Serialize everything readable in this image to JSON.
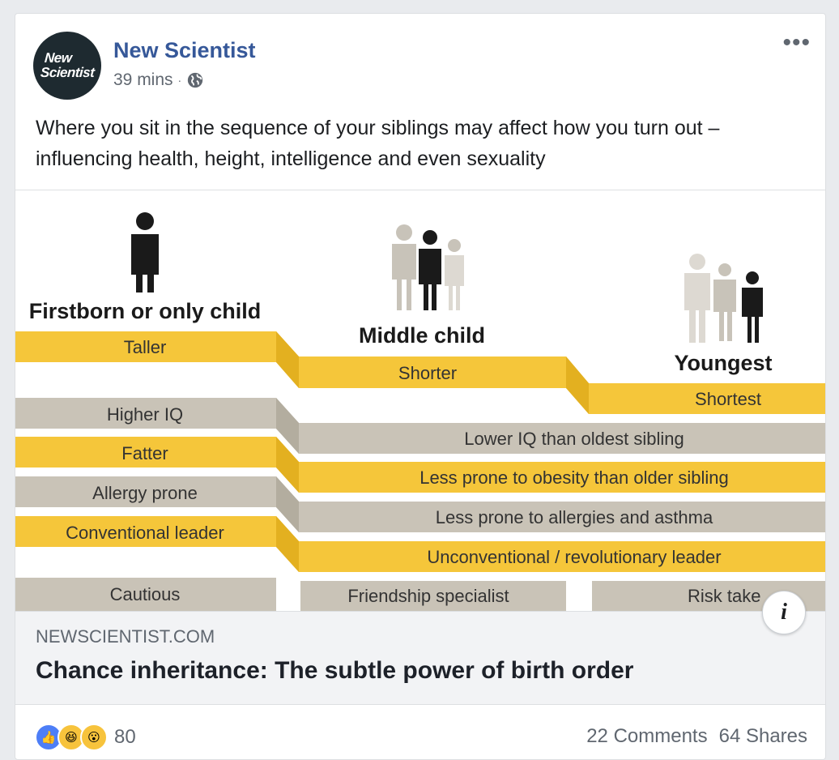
{
  "post": {
    "page_name": "New Scientist",
    "avatar_line1": "New",
    "avatar_line2": "Scientist",
    "time": "39 mins",
    "separator": "·",
    "privacy_icon": "globe-icon",
    "more_label": "•••",
    "text": "Where you sit in the sequence of your siblings may affect how you turn out – influencing health, height, intelligence and even sexuality"
  },
  "infographic": {
    "col1_title": "Firstborn or only child",
    "col2_title": "Middle child",
    "col3_title": "Youngest",
    "height_first": "Taller",
    "height_middle": "Shorter",
    "height_youngest": "Shortest",
    "first_traits": [
      "Higher IQ",
      "Fatter",
      "Allergy prone",
      "Conventional leader"
    ],
    "later_traits": [
      "Lower IQ than oldest sibling",
      "Less prone to obesity than older sibling",
      "Less prone to allergies and asthma",
      "Unconventional / revolutionary leader"
    ],
    "bottom_first": "Cautious",
    "bottom_middle": "Friendship specialist",
    "bottom_youngest": "Risk take",
    "colors": {
      "yellow": "#f5c63a",
      "gray": "#c9c3b7",
      "dark": "#1a1a1a",
      "light_figure": "#c8c3b9"
    }
  },
  "link": {
    "domain": "NEWSCIENTIST.COM",
    "headline": "Chance inheritance: The subtle power of birth order",
    "info_label": "i"
  },
  "footer": {
    "reaction_count": "80",
    "comments": "22 Comments",
    "shares": "64 Shares"
  }
}
